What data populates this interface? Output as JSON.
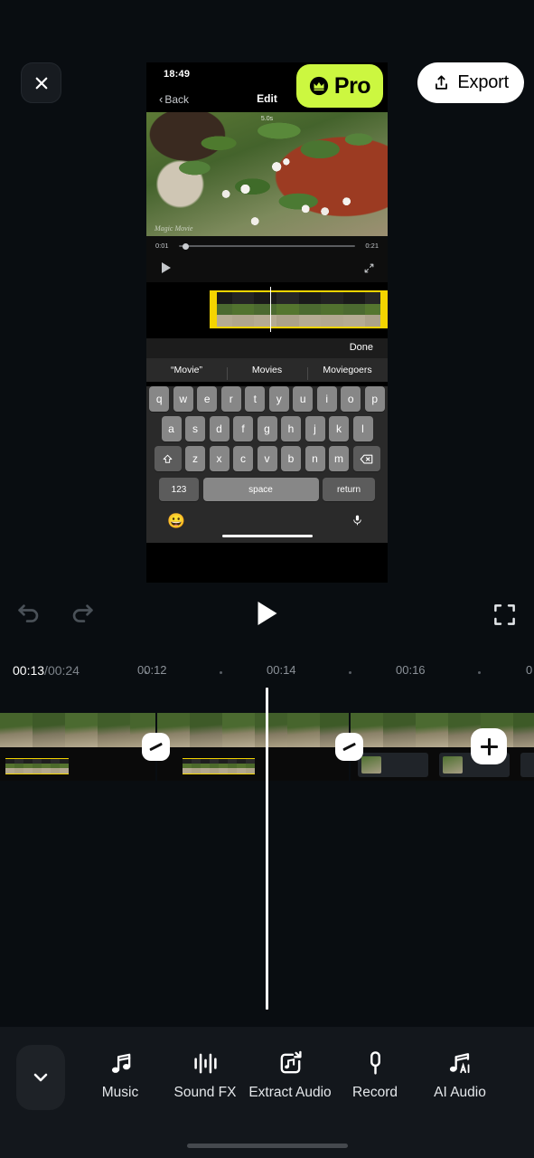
{
  "app": {
    "background_color": "#090d11",
    "accent_color": "#ccf740"
  },
  "topbar": {
    "close_icon": "close-icon",
    "export_label": "Export",
    "export_icon": "share-upload-icon"
  },
  "phone_preview": {
    "status_time": "18:49",
    "back_label": "Back",
    "back_chevron": "‹",
    "screen_title": "Edit",
    "pro_badge": {
      "label": "Pro",
      "icon": "crown-icon",
      "color": "#ccf740"
    },
    "preview": {
      "duration_label": "5.0s",
      "watermark": "Magic Movie"
    },
    "scrubber": {
      "current_time": "0:01",
      "total_time": "0:21",
      "play_icon": "play-icon",
      "expand_icon": "expand-arrows-icon"
    },
    "keyboard": {
      "done_label": "Done",
      "suggestions": [
        "“Movie”",
        "Movies",
        "Moviegoers"
      ],
      "row1": [
        "q",
        "w",
        "e",
        "r",
        "t",
        "y",
        "u",
        "i",
        "o",
        "p"
      ],
      "row2": [
        "a",
        "s",
        "d",
        "f",
        "g",
        "h",
        "j",
        "k",
        "l"
      ],
      "row3": [
        "z",
        "x",
        "c",
        "v",
        "b",
        "n",
        "m"
      ],
      "shift_icon": "shift-up-icon",
      "backspace_icon": "backspace-icon",
      "numbers_label": "123",
      "space_label": "space",
      "return_label": "return",
      "emoji_icon": "smiley-face-icon",
      "mic_icon": "microphone-icon"
    }
  },
  "playback": {
    "undo_icon": "undo-arrow-icon",
    "redo_icon": "redo-arrow-icon",
    "play_icon": "play-triangle-icon",
    "fullscreen_icon": "fullscreen-brackets-icon"
  },
  "timeline": {
    "current_time": "00:13",
    "separator": "/",
    "total_time": "00:24",
    "ruler_ticks": [
      "00:12",
      "00:14",
      "00:16",
      "0"
    ],
    "add_clip_icon": "plus-icon",
    "transition_icon": "transition-slash-icon",
    "playhead": "playhead-line"
  },
  "bottom_toolbar": {
    "collapse_icon": "chevron-down-icon",
    "tools": [
      {
        "label": "Music",
        "icon": "music-notes-icon"
      },
      {
        "label": "Sound FX",
        "icon": "waveform-bars-icon"
      },
      {
        "label": "Extract\nAudio",
        "icon": "extract-audio-icon"
      },
      {
        "label": "Record",
        "icon": "microphone-icon"
      },
      {
        "label": "AI Audio",
        "icon": "ai-audio-note-icon"
      }
    ]
  }
}
